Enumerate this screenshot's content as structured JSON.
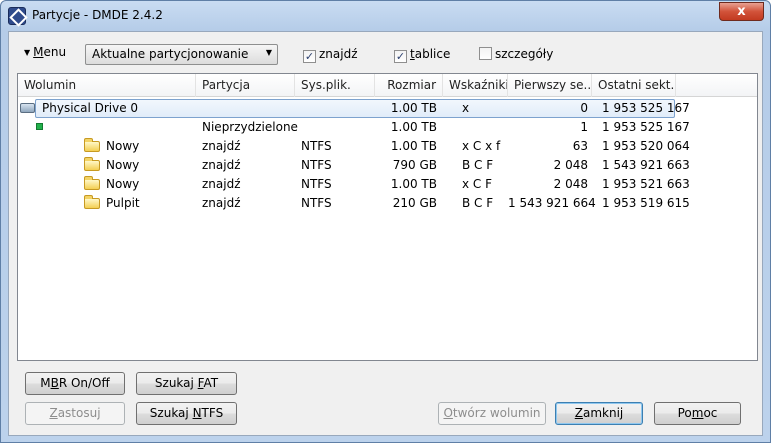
{
  "window": {
    "title": "Partycje - DMDE 2.4.2",
    "close_glyph": "x"
  },
  "toolbar": {
    "menu_label_u": "M",
    "menu_label_rest": "enu",
    "partition_view": "Aktualne partycjonowanie",
    "checks": [
      {
        "label": "znajdź",
        "checked": true
      },
      {
        "label_u": "t",
        "label_rest": "ablice",
        "checked": true
      },
      {
        "label": "szczegóły",
        "checked": false
      }
    ],
    "check_mark": "✓"
  },
  "table": {
    "columns": [
      "Wolumin",
      "Partycja",
      "Sys.plik.",
      "Rozmiar",
      "Wskaźniki",
      "Pierwszy se...",
      "Ostatni sekt..."
    ],
    "rows": [
      {
        "icon": "drive-icon",
        "volume": "Physical Drive 0",
        "partition": "",
        "fs": "",
        "size": "1.00 TB",
        "flags": "x",
        "first": "0",
        "last": "1 953 525 167",
        "selected": true
      },
      {
        "icon": "unallocated-icon",
        "volume": "",
        "partition": "Nieprzydzielone",
        "fs": "",
        "size": "1.00 TB",
        "flags": "",
        "first": "1",
        "last": "1 953 525 167"
      },
      {
        "icon": "folder-icon",
        "volume": "Nowy",
        "partition": "znajdź",
        "fs": "NTFS",
        "size": "1.00 TB",
        "flags": "x C x f",
        "first": "63",
        "last": "1 953 520 064"
      },
      {
        "icon": "folder-icon",
        "volume": "Nowy",
        "partition": "znajdź",
        "fs": "NTFS",
        "size": "790 GB",
        "flags": "B C F",
        "first": "2 048",
        "last": "1 543 921 663"
      },
      {
        "icon": "folder-icon",
        "volume": "Nowy",
        "partition": "znajdź",
        "fs": "NTFS",
        "size": "1.00 TB",
        "flags": "x C F",
        "first": "2 048",
        "last": "1 953 521 663"
      },
      {
        "icon": "folder-icon",
        "volume": "Pulpit",
        "partition": "znajdź",
        "fs": "NTFS",
        "size": "210 GB",
        "flags": "B C F",
        "first": "1 543 921 664",
        "last": "1 953 519 615"
      }
    ]
  },
  "buttons": {
    "mbr": {
      "u": "B",
      "pre": "M",
      "post": "R On/Off"
    },
    "fat": {
      "pre": "Szukaj ",
      "u": "F",
      "post": "AT"
    },
    "apply": {
      "pre": "",
      "u": "Z",
      "post": "astosuj"
    },
    "ntfs": {
      "pre": "Szukaj ",
      "u": "N",
      "post": "TFS"
    },
    "open": {
      "pre": "",
      "u": "O",
      "post": "twórz wolumin"
    },
    "close": {
      "pre": "",
      "u": "Z",
      "post": "amknij"
    },
    "help": {
      "pre": "Po",
      "u": "m",
      "post": "oc"
    }
  }
}
